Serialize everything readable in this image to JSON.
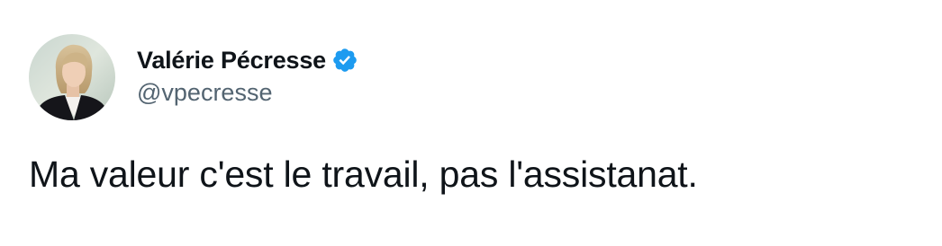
{
  "author": {
    "display_name": "Valérie Pécresse",
    "handle": "@vpecresse",
    "verified": true,
    "verified_icon": "verified-badge-icon",
    "avatar": "profile-photo"
  },
  "tweet": {
    "text": "Ma valeur c'est le travail, pas l'assistanat."
  },
  "colors": {
    "text_primary": "#0f1419",
    "text_secondary": "#536471",
    "verified_blue": "#1d9bf0",
    "background": "#ffffff"
  }
}
